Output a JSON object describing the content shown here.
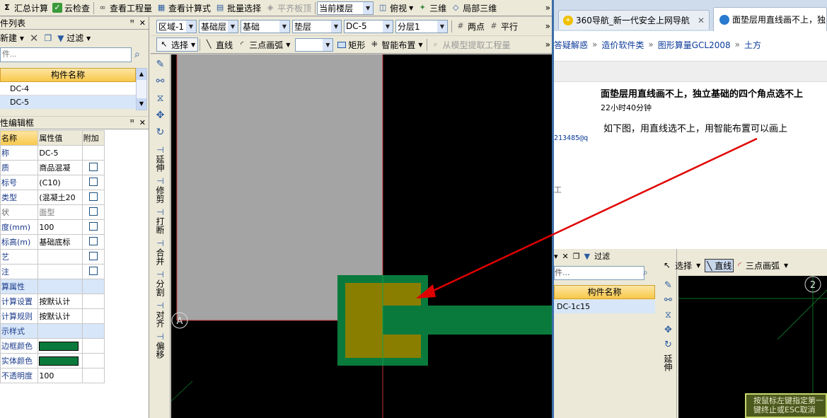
{
  "toolbar1": {
    "summary_calc": "汇总计算",
    "cloud_check": "云检查",
    "view_quantity": "查看工程量",
    "view_formula": "查看计算式",
    "batch_select": "批量选择",
    "flat_slab": "平齐板顶",
    "current_floor": "当前楼层",
    "top_view": "俯视",
    "view_3d": "三维",
    "local_3d": "局部三维",
    "more": "»"
  },
  "toolbar2": {
    "region": "区域-1",
    "layer": "基础层",
    "category": "基础",
    "subtype": "垫层",
    "component": "DC-5",
    "sublayer": "分层1",
    "two_point": "两点",
    "parallel": "平行",
    "more": "»"
  },
  "toolbar3": {
    "select": "选择",
    "line": "直线",
    "arc": "三点画弧",
    "rect": "矩形",
    "smart_place": "智能布置",
    "extract": "从模型提取工程量",
    "more": "»"
  },
  "component_panel": {
    "title": "件列表",
    "new_label": "新建",
    "filter_label": "过滤",
    "search_placeholder": "件...",
    "column_header": "构件名称",
    "items": [
      "DC-4",
      "DC-5"
    ]
  },
  "property_panel": {
    "title": "性编辑框",
    "col_name": "名称",
    "col_value": "属性值",
    "col_extra": "附加",
    "rows": [
      {
        "name": "称",
        "value": "DC-5",
        "check": false
      },
      {
        "name": "质",
        "value": "商品混凝",
        "check": true
      },
      {
        "name": "标号",
        "value": "(C10)",
        "check": true
      },
      {
        "name": "类型",
        "value": "(混凝土20",
        "check": true
      },
      {
        "name": "状",
        "value": "面型",
        "check": true,
        "gray": true
      },
      {
        "name": "度(mm)",
        "value": "100",
        "check": true
      },
      {
        "name": "标高(m)",
        "value": "基础底标",
        "check": true
      },
      {
        "name": "艺",
        "value": "",
        "check": true
      },
      {
        "name": "注",
        "value": "",
        "check": true
      },
      {
        "name": "算属性",
        "value": "",
        "check": false,
        "section": true
      },
      {
        "name": "计算设置",
        "value": "按默认计",
        "check": false
      },
      {
        "name": "计算规则",
        "value": "按默认计",
        "check": false
      },
      {
        "name": "示样式",
        "value": "",
        "check": false,
        "section": true
      },
      {
        "name": "边框颜色",
        "value": "",
        "swatch": "#0a7a3c"
      },
      {
        "name": "实体颜色",
        "value": "",
        "swatch": "#0a7a3c"
      },
      {
        "name": "不透明度",
        "value": "100",
        "check": false
      }
    ]
  },
  "vertical_tools": [
    "延伸",
    "修剪",
    "打断",
    "合并",
    "分割",
    "对齐",
    "偏移"
  ],
  "canvas": {
    "axis_label": "A"
  },
  "browser": {
    "tab1": "360导航_新一代安全上网导航",
    "tab2": "面垫层用直线画不上，独",
    "breadcrumb": [
      "答疑解惑",
      "造价软件类",
      "图形算量GCL2008",
      "土方"
    ],
    "question_title": "面垫层用直线画不上，独立基础的四个角点选不上",
    "time_ago": "22小时40分钟",
    "user_id": "213485@q",
    "body_text": "如下图，用直线选不上，用智能布置可以画上",
    "side_char": "工"
  },
  "embedded": {
    "select": "选择",
    "line": "直线",
    "arc": "三点画弧",
    "filter": "过滤",
    "column_header": "构件名称",
    "item": "DC-1c15",
    "search_placeholder": "件...",
    "axis_label": "2",
    "hint": "按鼠标左键指定第一",
    "hint2": "键终止或ESC取消"
  },
  "colors": {
    "foundation_green": "#0a7a3c",
    "cushion_olive": "#8a7e00",
    "arrow_red": "#e00000",
    "canvas_bg": "#000000",
    "gray_area": "#a4a4a4"
  }
}
